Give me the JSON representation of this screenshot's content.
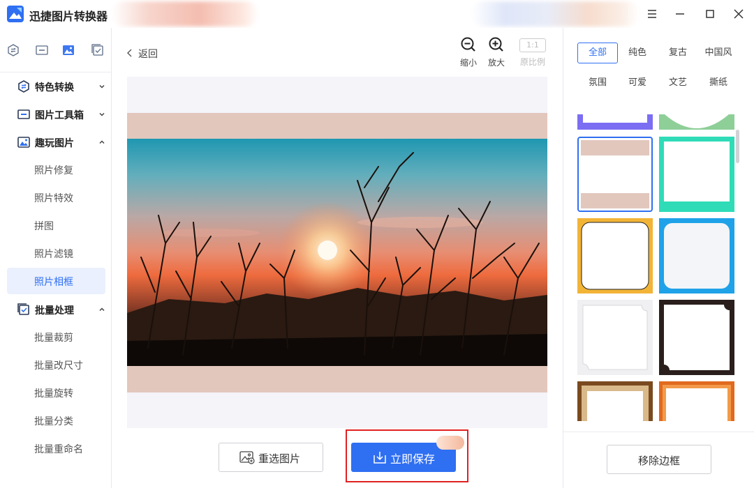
{
  "app": {
    "title": "迅捷图片转换器"
  },
  "window_controls": [
    "menu-icon",
    "minimize-icon",
    "maximize-icon",
    "close-icon"
  ],
  "sidebar": {
    "tabs": [
      "convert-icon",
      "toolbox-icon",
      "image-icon",
      "batch-icon"
    ],
    "sections": [
      {
        "label": "特色转换",
        "icon": "convert-icon",
        "expanded": false
      },
      {
        "label": "图片工具箱",
        "icon": "toolbox-icon",
        "expanded": false
      },
      {
        "label": "趣玩图片",
        "icon": "image-icon",
        "expanded": true,
        "items": [
          "照片修复",
          "照片特效",
          "拼图",
          "照片滤镜",
          "照片相框"
        ]
      },
      {
        "label": "批量处理",
        "icon": "batch-icon",
        "expanded": true,
        "items": [
          "批量裁剪",
          "批量改尺寸",
          "批量旋转",
          "批量分类",
          "批量重命名"
        ]
      }
    ],
    "active_item": "照片相框"
  },
  "toolbar": {
    "back_label": "返回",
    "zoom_out_label": "缩小",
    "zoom_in_label": "放大",
    "ratio_badge": "1:1",
    "ratio_label": "原比例"
  },
  "actions": {
    "reselect_label": "重选图片",
    "save_label": "立即保存"
  },
  "frames_panel": {
    "categories": [
      "全部",
      "纯色",
      "复古",
      "中国风",
      "氛围",
      "可爱",
      "文艺",
      "撕纸"
    ],
    "active_category": "全部",
    "remove_label": "移除边框"
  },
  "colors": {
    "accent": "#2f6ff2",
    "highlight": "#e02020",
    "frame_preview": "#e2c7bd",
    "canvas_bg": "#f4f4f9"
  }
}
